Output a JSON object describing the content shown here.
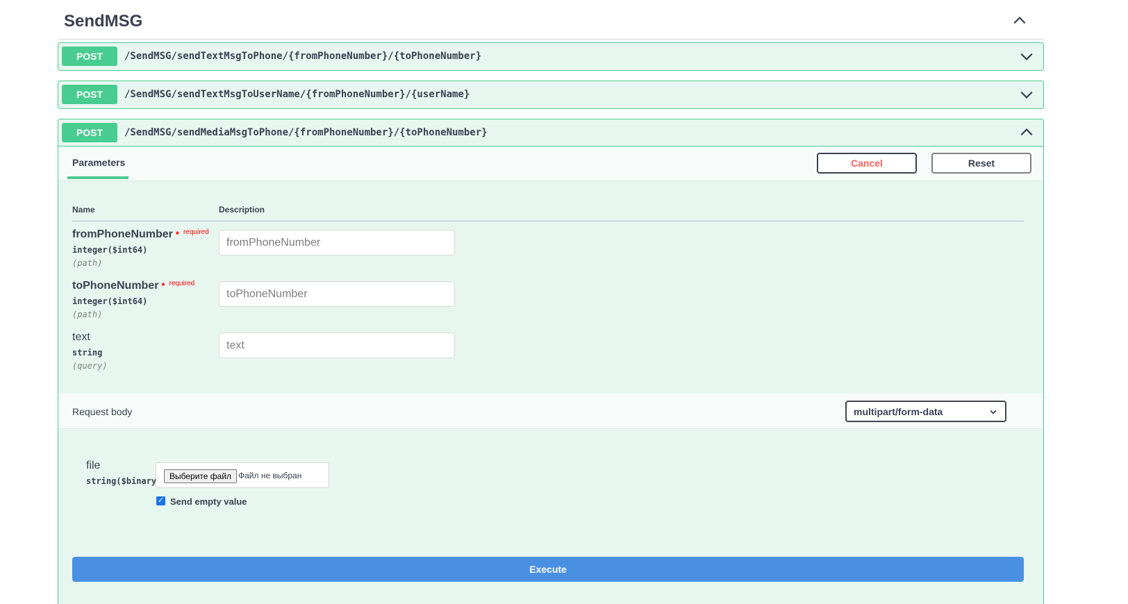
{
  "tag": {
    "title": "SendMSG"
  },
  "operations": [
    {
      "method": "POST",
      "path": "/SendMSG/sendTextMsgToPhone/{fromPhoneNumber}/{toPhoneNumber}"
    },
    {
      "method": "POST",
      "path": "/SendMSG/sendTextMsgToUserName/{fromPhoneNumber}/{userName}"
    },
    {
      "method": "POST",
      "path": "/SendMSG/sendMediaMsgToPhone/{fromPhoneNumber}/{toPhoneNumber}"
    }
  ],
  "expanded": {
    "tab_label": "Parameters",
    "cancel_label": "Cancel",
    "reset_label": "Reset",
    "columns": {
      "name": "Name",
      "description": "Description"
    },
    "params": [
      {
        "name": "fromPhoneNumber",
        "required_star": "*",
        "required_label": "required",
        "type": "integer($int64)",
        "in": "(path)",
        "placeholder": "fromPhoneNumber"
      },
      {
        "name": "toPhoneNumber",
        "required_star": "*",
        "required_label": "required",
        "type": "integer($int64)",
        "in": "(path)",
        "placeholder": "toPhoneNumber"
      },
      {
        "name": "text",
        "type": "string",
        "in": "(query)",
        "placeholder": "text"
      }
    ],
    "request_body": {
      "title": "Request body",
      "content_type": "multipart/form-data",
      "file": {
        "name": "file",
        "type": "string($binary)",
        "button_label": "Выберите файл",
        "status": "Файл не выбран"
      },
      "send_empty_label": "Send empty value",
      "send_empty_checked": true
    },
    "execute_label": "Execute"
  },
  "colors": {
    "post": "#49cc90",
    "post_bg": "#e8f6f0",
    "execute": "#4990e2",
    "cancel_text": "#ff6060",
    "required": "#ff0000"
  }
}
